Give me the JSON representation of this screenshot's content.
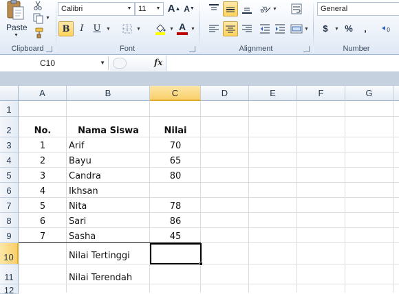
{
  "ribbon": {
    "paste_label": "Paste",
    "clipboard_label": "Clipboard",
    "font_label": "Font",
    "alignment_label": "Alignment",
    "number_label": "Number",
    "font_name": "Calibri",
    "font_size": "11",
    "number_format": "General",
    "bold_glyph": "B",
    "italic_glyph": "I",
    "underline_glyph": "U",
    "grow_font_glyph": "A",
    "shrink_font_glyph": "A",
    "font_color_glyph": "A",
    "currency_glyph": "$",
    "percent_glyph": "%",
    "comma_glyph": ",",
    "accent_color": "#ffd35c",
    "font_color": "#c00000",
    "fill_color": "#ffff00"
  },
  "formula_bar": {
    "name_box": "C10",
    "fx_label": "fx",
    "formula": ""
  },
  "columns": [
    "A",
    "B",
    "C",
    "D",
    "E",
    "F",
    "G"
  ],
  "selected_column": "C",
  "rows": [
    "1",
    "2",
    "3",
    "4",
    "5",
    "6",
    "7",
    "8",
    "9",
    "10",
    "11",
    "12"
  ],
  "selected_row": "10",
  "table": {
    "header": {
      "no": "No.",
      "name": "Nama Siswa",
      "score": "Nilai"
    },
    "records": [
      {
        "no": "1",
        "name": "Arif",
        "score": "70"
      },
      {
        "no": "2",
        "name": "Bayu",
        "score": "65"
      },
      {
        "no": "3",
        "name": "Candra",
        "score": "80"
      },
      {
        "no": "4",
        "name": "Ikhsan",
        "score": ""
      },
      {
        "no": "5",
        "name": "Nita",
        "score": "78"
      },
      {
        "no": "6",
        "name": "Sari",
        "score": "86"
      },
      {
        "no": "7",
        "name": "Sasha",
        "score": "45"
      }
    ],
    "summary": {
      "highest_label": "Nilai Tertinggi",
      "lowest_label": "Nilai Terendah"
    }
  }
}
